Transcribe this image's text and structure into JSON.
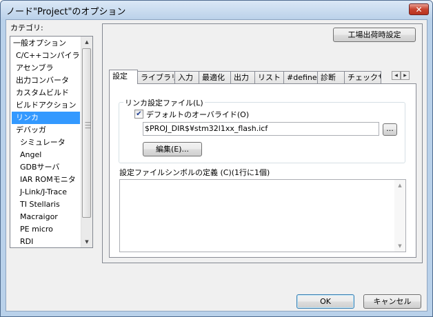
{
  "window": {
    "title": "ノード\"Project\"のオプション",
    "close_icon": "close-icon",
    "close_glyph": "✕"
  },
  "category": {
    "label": "カテゴリ:",
    "items": [
      {
        "label": "一般オプション",
        "indent": 0,
        "selected": false
      },
      {
        "label": "C/C++コンパイラ",
        "indent": 1,
        "selected": false
      },
      {
        "label": "アセンブラ",
        "indent": 1,
        "selected": false
      },
      {
        "label": "出力コンバータ",
        "indent": 1,
        "selected": false
      },
      {
        "label": "カスタムビルド",
        "indent": 1,
        "selected": false
      },
      {
        "label": "ビルドアクション",
        "indent": 1,
        "selected": false
      },
      {
        "label": "リンカ",
        "indent": 1,
        "selected": true
      },
      {
        "label": "デバッガ",
        "indent": 1,
        "selected": false
      },
      {
        "label": "シミュレータ",
        "indent": 2,
        "selected": false
      },
      {
        "label": "Angel",
        "indent": 2,
        "selected": false
      },
      {
        "label": "GDBサーバ",
        "indent": 2,
        "selected": false
      },
      {
        "label": "IAR ROMモニタ",
        "indent": 2,
        "selected": false
      },
      {
        "label": "J-Link/J-Trace",
        "indent": 2,
        "selected": false
      },
      {
        "label": "TI Stellaris",
        "indent": 2,
        "selected": false
      },
      {
        "label": "Macraigor",
        "indent": 2,
        "selected": false
      },
      {
        "label": "PE micro",
        "indent": 2,
        "selected": false
      },
      {
        "label": "RDI",
        "indent": 2,
        "selected": false
      }
    ],
    "scroll_up": "▲",
    "scroll_down": "▼"
  },
  "panel": {
    "factory_button": "工場出荷時設定",
    "tabs": [
      {
        "label": "設定",
        "active": true
      },
      {
        "label": "ライブラリ",
        "active": false
      },
      {
        "label": "入力",
        "active": false
      },
      {
        "label": "最適化",
        "active": false
      },
      {
        "label": "出力",
        "active": false
      },
      {
        "label": "リスト",
        "active": false
      },
      {
        "label": "#define",
        "active": false
      },
      {
        "label": "診断",
        "active": false
      },
      {
        "label": "チェックサム",
        "active": false
      }
    ],
    "tab_scroll_left": "◀",
    "tab_scroll_right": "▶",
    "linker_group": {
      "title": "リンカ設定ファイル(L)",
      "override_label": "デフォルトのオーバライド(O)",
      "override_checked": true,
      "check_glyph": "✔",
      "file_path": "$PROJ_DIR$¥stm32l1xx_flash.icf",
      "browse_button": "...",
      "edit_button": "編集(E)..."
    },
    "symbols_label": "設定ファイルシンボルの定義 (C)(1行に1個)",
    "symbols_value": ""
  },
  "footer": {
    "ok_button": "OK",
    "cancel_button": "キャンセル"
  }
}
